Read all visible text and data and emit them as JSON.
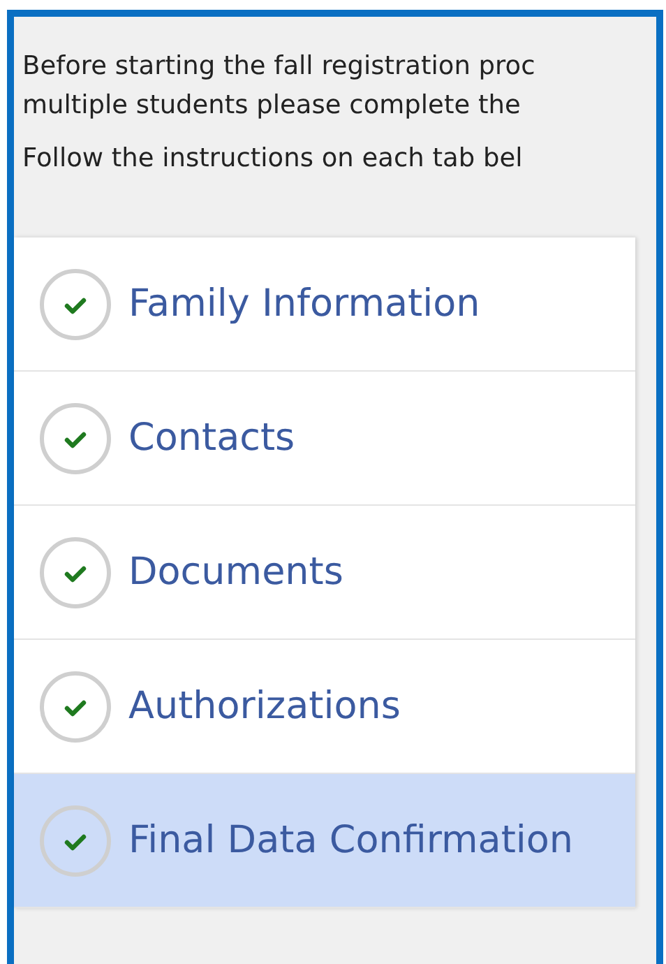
{
  "intro": [
    "Before starting the fall registration proc",
    "multiple students please complete the",
    "Follow the instructions on each tab bel"
  ],
  "tabs": [
    {
      "label": "Family Information",
      "completed": true,
      "selected": false
    },
    {
      "label": "Contacts",
      "completed": true,
      "selected": false
    },
    {
      "label": "Documents",
      "completed": true,
      "selected": false
    },
    {
      "label": "Authorizations",
      "completed": true,
      "selected": false
    },
    {
      "label": "Final Data Confirmation",
      "completed": true,
      "selected": true
    }
  ]
}
